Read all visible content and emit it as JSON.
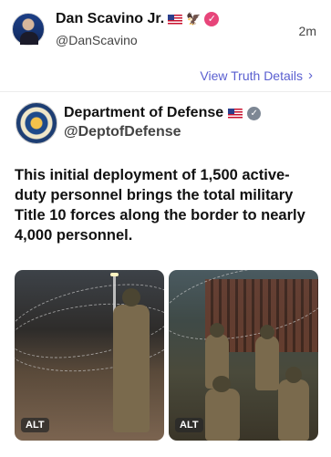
{
  "post": {
    "author_name": "Dan Scavino Jr.",
    "handle": "@DanScavino",
    "timestamp": "2m",
    "view_details": "View Truth Details"
  },
  "shared": {
    "name": "Department of Defense",
    "handle": "@DeptofDefense",
    "text": "This initial deployment of 1,500 active-duty personnel brings the total military Title 10 forces along the border to nearly 4,000 personnel.",
    "alt_left": "ALT",
    "alt_right": "ALT"
  },
  "icons": {
    "author_flag": "us-flag-icon",
    "author_eagle": "eagle-icon",
    "author_badge": "verified-badge-icon",
    "dod_flag": "us-flag-icon",
    "dod_badge": "verified-badge-icon",
    "details_chevron": "chevron-right-icon"
  },
  "colors": {
    "link": "#5a5fd0",
    "author_badge": "#e7457a",
    "dod_badge": "#7d8794"
  }
}
